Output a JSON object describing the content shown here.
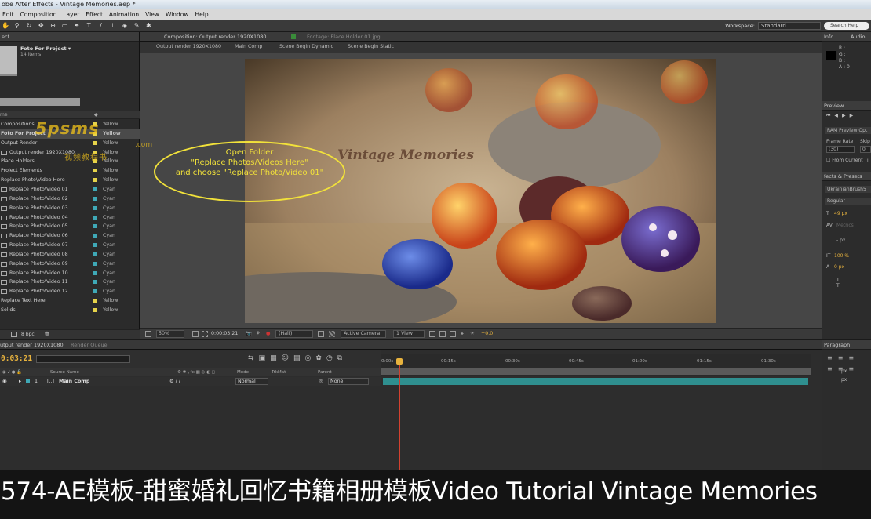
{
  "window": {
    "title": "obe After Effects - Vintage Memories.aep *"
  },
  "menu": [
    "Edit",
    "Composition",
    "Layer",
    "Effect",
    "Animation",
    "View",
    "Window",
    "Help"
  ],
  "workspace": {
    "label": "Workspace:",
    "value": "Standard",
    "search_placeholder": "Search Help"
  },
  "project": {
    "tab": "ect",
    "name": "Foto For Project ▾",
    "count": "14 items",
    "col_name": "me",
    "items": [
      {
        "name": "Compositions",
        "label": "Yellow",
        "color": "yellow",
        "indent": false
      },
      {
        "name": "Foto For Project",
        "label": "Yellow",
        "color": "yellow",
        "indent": false
      },
      {
        "name": "Output Render",
        "label": "Yellow",
        "color": "yellow",
        "indent": false
      },
      {
        "name": "Output render 1920X1080",
        "label": "Yellow",
        "color": "yellow",
        "indent": true
      },
      {
        "name": "Place Holders",
        "label": "Yellow",
        "color": "yellow",
        "indent": false
      },
      {
        "name": "Project Elements",
        "label": "Yellow",
        "color": "yellow",
        "indent": false
      },
      {
        "name": "Replace Photo\\Video Here",
        "label": "Yellow",
        "color": "yellow",
        "indent": false
      },
      {
        "name": "Replace Photo\\Video 01",
        "label": "Cyan",
        "color": "cyan",
        "indent": true
      },
      {
        "name": "Replace Photo\\Video 02",
        "label": "Cyan",
        "color": "cyan",
        "indent": true
      },
      {
        "name": "Replace Photo\\Video 03",
        "label": "Cyan",
        "color": "cyan",
        "indent": true
      },
      {
        "name": "Replace Photo\\Video 04",
        "label": "Cyan",
        "color": "cyan",
        "indent": true
      },
      {
        "name": "Replace Photo\\Video 05",
        "label": "Cyan",
        "color": "cyan",
        "indent": true
      },
      {
        "name": "Replace Photo\\Video 06",
        "label": "Cyan",
        "color": "cyan",
        "indent": true
      },
      {
        "name": "Replace Photo\\Video 07",
        "label": "Cyan",
        "color": "cyan",
        "indent": true
      },
      {
        "name": "Replace Photo\\Video 08",
        "label": "Cyan",
        "color": "cyan",
        "indent": true
      },
      {
        "name": "Replace Photo\\Video 09",
        "label": "Cyan",
        "color": "cyan",
        "indent": true
      },
      {
        "name": "Replace Photo\\Video 10",
        "label": "Cyan",
        "color": "cyan",
        "indent": true
      },
      {
        "name": "Replace Photo\\Video 11",
        "label": "Cyan",
        "color": "cyan",
        "indent": true
      },
      {
        "name": "Replace Photo\\Video 12",
        "label": "Cyan",
        "color": "cyan",
        "indent": true
      },
      {
        "name": "Replace Text Here",
        "label": "Yellow",
        "color": "yellow",
        "indent": false
      },
      {
        "name": "Solids",
        "label": "Yellow",
        "color": "yellow",
        "indent": false
      }
    ],
    "bpc": "8 bpc"
  },
  "composition": {
    "tab": "Composition: Output render 1920X1080",
    "footage_tab": "Footage: Place Holder 01.jpg",
    "crumbs": [
      "Output render 1920X1080",
      "Main Comp",
      "Scene Begin Dynamic",
      "Scene Begin Static"
    ],
    "zoom": "50%",
    "timecode": "0:00:03:21",
    "resolution": "(Half)",
    "camera": "Active Camera",
    "view": "1 View",
    "exposure": "+0.0",
    "overlay_title": "Vintage Memories"
  },
  "annotation": {
    "line1": "Open Folder",
    "line2": "\"Replace Photos/Videos Here\"",
    "line3": "and choose \"Replace Photo/Video 01\""
  },
  "watermark": {
    "main": "5psms",
    "sub": "视频教程书",
    "com": ".com"
  },
  "info": {
    "tab": "Info",
    "audio_tab": "Audio",
    "r": "R :",
    "g": "G :",
    "b": "B :",
    "a": "A : 0"
  },
  "preview": {
    "tab": "Preview",
    "ram": "RAM Preview Opt",
    "frame_rate": "Frame Rate",
    "skip": "Skip",
    "fr_val": "(30)",
    "skip_val": "0",
    "from_current": "From Current Ti"
  },
  "character": {
    "tab": "fects & Presets",
    "font": "UkrainianBrush5",
    "style": "Regular",
    "size": "49 px",
    "tracking": "Metrics",
    "unit": "- px",
    "scale": "100 %",
    "baseline": "0 px"
  },
  "timeline": {
    "tab": "utput render 1920X1080",
    "render_tab": "Render Queue",
    "timecode": "0:03:21",
    "col_source": "Source Name",
    "col_mode": "Mode",
    "col_trkmat": "TrkMat",
    "col_parent": "Parent",
    "layer_index": "1",
    "layer_name": "Main Comp",
    "layer_mode": "Normal",
    "layer_parent": "None",
    "ruler": [
      "0:00s",
      "00:15s",
      "00:30s",
      "00:45s",
      "01:00s",
      "01:15s",
      "01:30s"
    ]
  },
  "paragraph": {
    "tab": "Paragraph",
    "px1": "px",
    "px2": "px"
  },
  "caption": "574-AE模板-甜蜜婚礼回忆书籍相册模板Video Tutorial Vintage Memories"
}
